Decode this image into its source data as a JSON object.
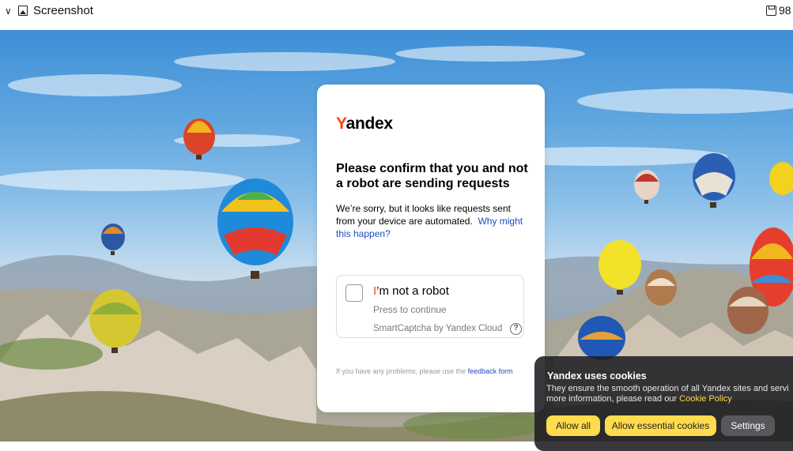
{
  "viewer": {
    "title": "Screenshot",
    "size_label": "98"
  },
  "card": {
    "logo_first": "Y",
    "logo_rest": "andex",
    "heading": "Please confirm that you and not a robot are sending requests",
    "description": "We’re sorry, but it looks like requests sent from your device are automated.",
    "why_link": "Why might this happen?",
    "captcha": {
      "label_first": "I",
      "label_rest": "’m not a robot",
      "hint": "Press to continue",
      "brand": "SmartCaptcha by Yandex Cloud",
      "help_symbol": "?"
    },
    "footer_text": "If you have any problems, please use the",
    "footer_link": "feedback form"
  },
  "cookies": {
    "title": "Yandex uses cookies",
    "line1": "They ensure the smooth operation of all Yandex sites and servi",
    "line2_prefix": "more information, please read our",
    "policy_link": "Cookie Policy",
    "allow_all": "Allow all",
    "allow_essential": "Allow essential cookies",
    "settings": "Settings"
  },
  "colors": {
    "brand_red": "#fc3f1d",
    "link_blue": "#1f4cbd",
    "cookie_button_yellow": "#ffdb4d"
  }
}
